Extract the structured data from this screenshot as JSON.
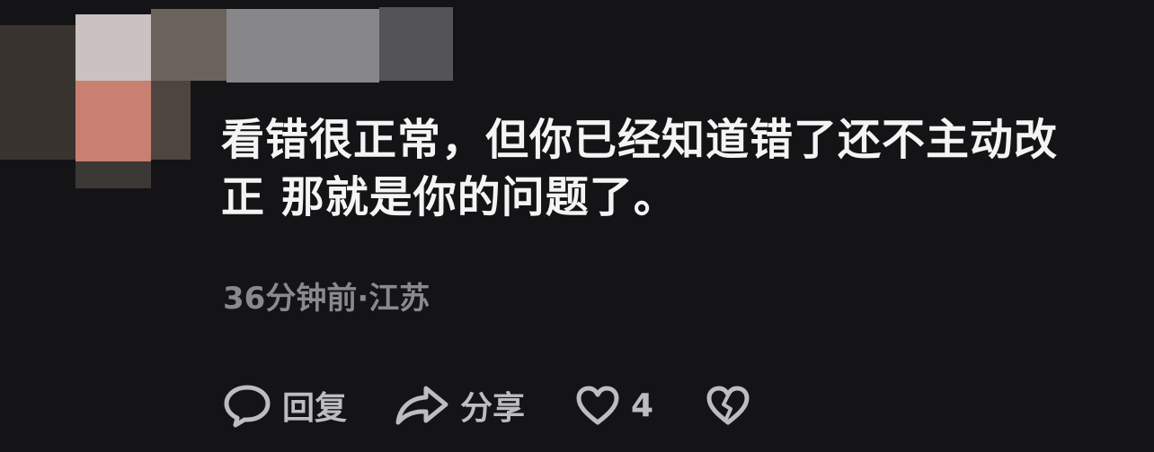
{
  "comment": {
    "avatar_icon": "blurred-avatar",
    "username": "",
    "text_lines": [
      "看错很正常，但你已经知道错了还不主动改",
      "正 那就是你的问题了。"
    ],
    "time": "36分钟前",
    "separator": "·",
    "location": "江苏"
  },
  "actions": {
    "reply_icon": "speech-bubble-icon",
    "reply_label": "回复",
    "share_icon": "share-arrow-icon",
    "share_label": "分享",
    "like_icon": "heart-icon",
    "like_count": "4",
    "dislike_icon": "broken-heart-icon"
  },
  "colors": {
    "background": "#141416",
    "text": "#f4f4f4",
    "meta": "#8a8a8e",
    "icons": "#bdbdc0"
  }
}
